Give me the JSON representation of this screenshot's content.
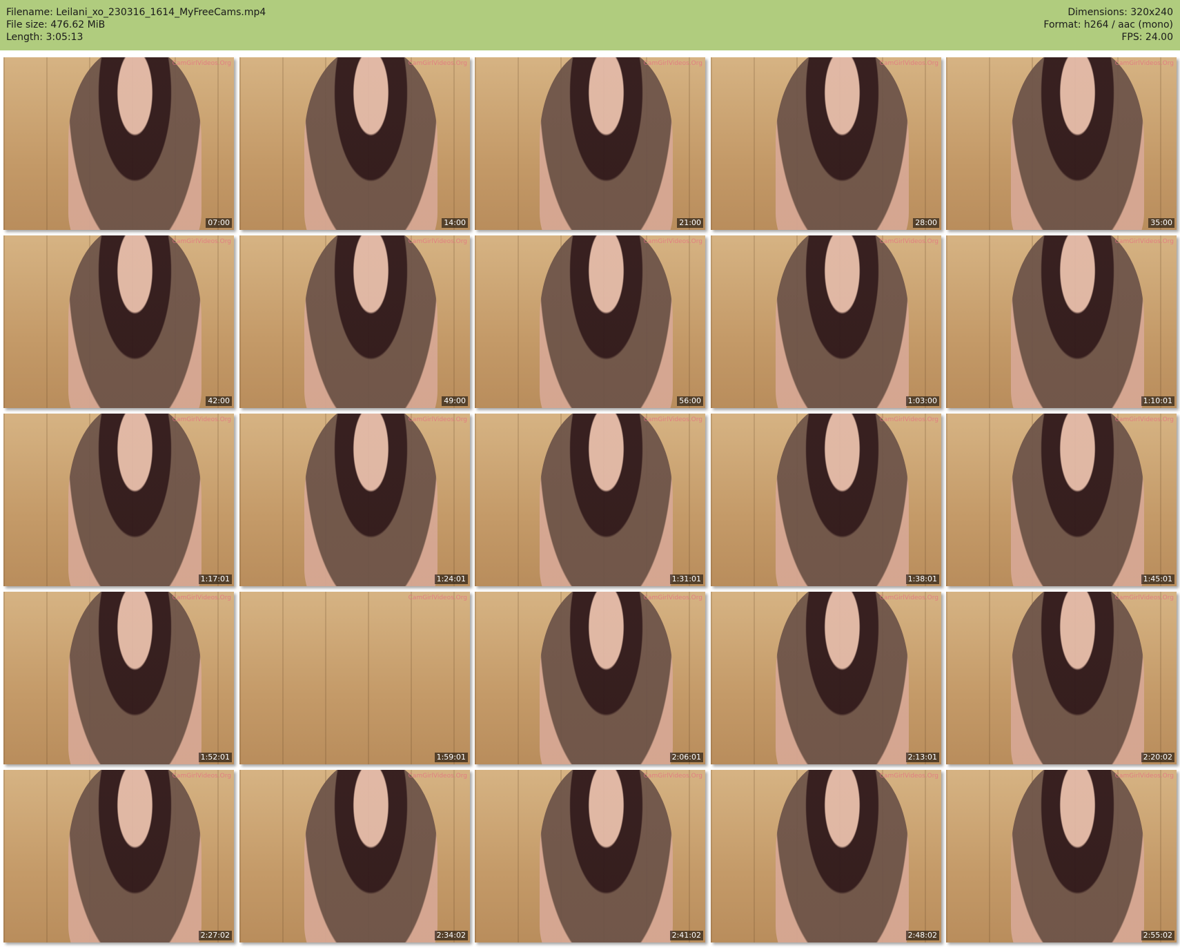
{
  "header": {
    "filename_label": "Filename: Leilani_xo_230316_1614_MyFreeCams.mp4",
    "filesize_label": "File size: 476.62 MiB",
    "length_label": "Length: 3:05:13",
    "dimensions_label": "Dimensions: 320x240",
    "format_label": "Format: h264 / aac (mono)",
    "fps_label": "FPS: 24.00",
    "background_color": "#b0cc7e"
  },
  "watermark_text": "CamGirlVideos.Org",
  "thumbnails": [
    {
      "timestamp": "07:00"
    },
    {
      "timestamp": "14:00"
    },
    {
      "timestamp": "21:00"
    },
    {
      "timestamp": "28:00"
    },
    {
      "timestamp": "35:00"
    },
    {
      "timestamp": "42:00"
    },
    {
      "timestamp": "49:00"
    },
    {
      "timestamp": "56:00"
    },
    {
      "timestamp": "1:03:00"
    },
    {
      "timestamp": "1:10:01"
    },
    {
      "timestamp": "1:17:01"
    },
    {
      "timestamp": "1:24:01"
    },
    {
      "timestamp": "1:31:01"
    },
    {
      "timestamp": "1:38:01"
    },
    {
      "timestamp": "1:45:01"
    },
    {
      "timestamp": "1:52:01"
    },
    {
      "timestamp": "1:59:01",
      "empty": true
    },
    {
      "timestamp": "2:06:01"
    },
    {
      "timestamp": "2:13:01"
    },
    {
      "timestamp": "2:20:02"
    },
    {
      "timestamp": "2:27:02"
    },
    {
      "timestamp": "2:34:02"
    },
    {
      "timestamp": "2:41:02"
    },
    {
      "timestamp": "2:48:02"
    },
    {
      "timestamp": "2:55:02"
    }
  ]
}
